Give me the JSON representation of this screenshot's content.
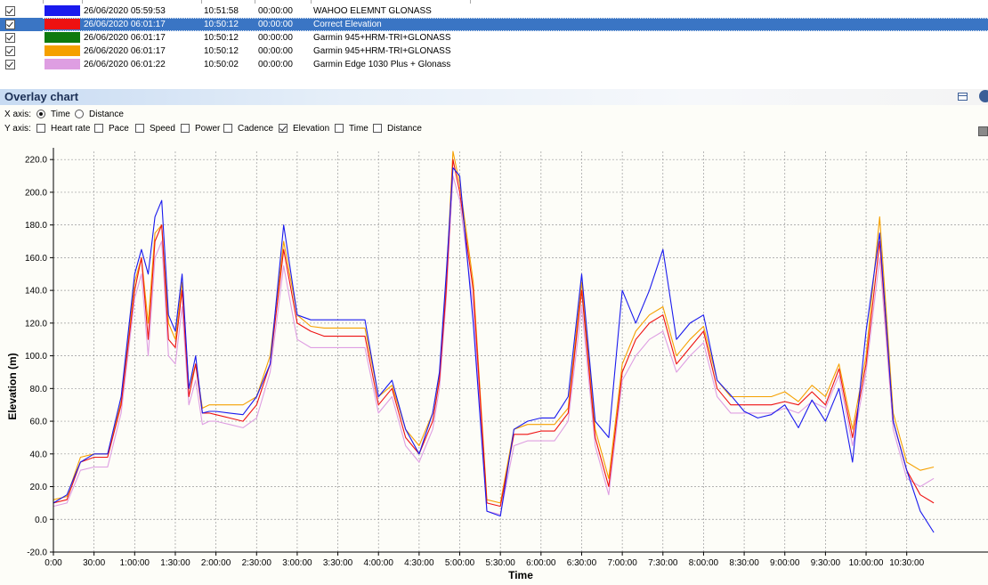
{
  "activities": [
    {
      "checked": true,
      "color": "#1a1aee",
      "date": "26/06/2020 05:59:53",
      "duration": "10:51:58",
      "pause": "00:00:00",
      "name": "WAHOO ELEMNT GLONASS",
      "selected": false
    },
    {
      "checked": true,
      "color": "#ee1111",
      "date": "26/06/2020 06:01:17",
      "duration": "10:50:12",
      "pause": "00:00:00",
      "name": "Correct Elevation",
      "selected": true
    },
    {
      "checked": true,
      "color": "#0e7a0e",
      "date": "26/06/2020 06:01:17",
      "duration": "10:50:12",
      "pause": "00:00:00",
      "name": "Garmin 945+HRM-TRI+GLONASS",
      "selected": false
    },
    {
      "checked": true,
      "color": "#f5a000",
      "date": "26/06/2020 06:01:17",
      "duration": "10:50:12",
      "pause": "00:00:00",
      "name": "Garmin 945+HRM-TRI+GLONASS",
      "selected": false
    },
    {
      "checked": true,
      "color": "#de9ee2",
      "date": "26/06/2020 06:01:22",
      "duration": "10:50:02",
      "pause": "00:00:00",
      "name": "Garmin Edge 1030 Plus + Glonass",
      "selected": false
    }
  ],
  "panel": {
    "title": "Overlay chart"
  },
  "xaxis_options": {
    "label": "X axis:",
    "options": [
      {
        "label": "Time",
        "selected": true
      },
      {
        "label": "Distance",
        "selected": false
      }
    ]
  },
  "yaxis_options": {
    "label": "Y axis:",
    "options": [
      {
        "label": "Heart rate",
        "checked": false
      },
      {
        "label": "Pace",
        "checked": false
      },
      {
        "label": "Speed",
        "checked": false
      },
      {
        "label": "Power",
        "checked": false
      },
      {
        "label": "Cadence",
        "checked": false
      },
      {
        "label": "Elevation",
        "checked": true
      },
      {
        "label": "Time",
        "checked": false
      },
      {
        "label": "Distance",
        "checked": false
      }
    ]
  },
  "chart_data": {
    "type": "line",
    "xlabel": "Time",
    "ylabel": "Elevation (m)",
    "ylim": [
      -20,
      225
    ],
    "yticks": [
      -20,
      0,
      20,
      40,
      60,
      80,
      100,
      120,
      140,
      160,
      180,
      200,
      220
    ],
    "ytick_labels": [
      "-20.0",
      "0.0",
      "20.0",
      "40.0",
      "60.0",
      "80.0",
      "100.0",
      "120.0",
      "140.0",
      "160.0",
      "180.0",
      "200.0",
      "220.0"
    ],
    "xlim": [
      "0:00",
      "11:30"
    ],
    "xtick_labels": [
      "0:00",
      "30:00",
      "1:00:00",
      "1:30:00",
      "2:00:00",
      "2:30:00",
      "3:00:00",
      "3:30:00",
      "4:00:00",
      "4:30:00",
      "5:00:00",
      "5:30:00",
      "6:00:00",
      "6:30:00",
      "7:00:00",
      "7:30:00",
      "8:00:00",
      "8:30:00",
      "9:00:00",
      "9:30:00",
      "10:00:00",
      "10:30:00"
    ],
    "grid": true,
    "x": [
      "0:00",
      "0:10",
      "0:20",
      "0:30",
      "0:40",
      "0:50",
      "1:00",
      "1:05",
      "1:10",
      "1:15",
      "1:20",
      "1:25",
      "1:30",
      "1:35",
      "1:40",
      "1:45",
      "1:50",
      "1:55",
      "2:00",
      "2:10",
      "2:20",
      "2:30",
      "2:40",
      "2:50",
      "3:00",
      "3:10",
      "3:20",
      "3:30",
      "3:40",
      "3:50",
      "4:00",
      "4:10",
      "4:20",
      "4:30",
      "4:40",
      "4:45",
      "4:50",
      "4:55",
      "5:00",
      "5:10",
      "5:20",
      "5:30",
      "5:40",
      "5:50",
      "6:00",
      "6:10",
      "6:20",
      "6:30",
      "6:40",
      "6:50",
      "7:00",
      "7:10",
      "7:20",
      "7:30",
      "7:40",
      "7:50",
      "8:00",
      "8:10",
      "8:20",
      "8:30",
      "8:40",
      "8:50",
      "9:00",
      "9:10",
      "9:20",
      "9:30",
      "9:40",
      "9:50",
      "10:00",
      "10:10",
      "10:20",
      "10:30",
      "10:40",
      "10:50"
    ],
    "series": [
      {
        "name": "WAHOO ELEMNT GLONASS",
        "color": "#1a1aee",
        "values": [
          10,
          15,
          35,
          40,
          40,
          75,
          150,
          165,
          150,
          185,
          195,
          125,
          115,
          150,
          80,
          100,
          65,
          66,
          66,
          65,
          64,
          75,
          95,
          180,
          125,
          122,
          122,
          122,
          122,
          122,
          75,
          85,
          55,
          40,
          65,
          90,
          150,
          215,
          210,
          120,
          5,
          2,
          55,
          60,
          62,
          62,
          75,
          150,
          60,
          50,
          140,
          120,
          140,
          165,
          110,
          120,
          125,
          85,
          76,
          66,
          62,
          64,
          70,
          56,
          73,
          60,
          80,
          35,
          115,
          175,
          60,
          30,
          5,
          -8
        ]
      },
      {
        "name": "Correct Elevation",
        "color": "#ee1111",
        "values": [
          10,
          12,
          35,
          38,
          38,
          70,
          140,
          160,
          110,
          170,
          180,
          110,
          105,
          140,
          75,
          95,
          65,
          65,
          64,
          62,
          60,
          70,
          95,
          165,
          120,
          115,
          112,
          112,
          112,
          112,
          70,
          80,
          50,
          40,
          60,
          85,
          140,
          220,
          200,
          140,
          10,
          8,
          52,
          52,
          54,
          54,
          65,
          140,
          50,
          20,
          90,
          110,
          120,
          125,
          95,
          105,
          115,
          80,
          70,
          70,
          70,
          70,
          72,
          70,
          78,
          70,
          92,
          50,
          95,
          170,
          60,
          30,
          15,
          10
        ]
      },
      {
        "name": "Garmin 945+HRM-TRI+GLONASS",
        "color": "#f5a000",
        "values": [
          12,
          14,
          38,
          40,
          40,
          72,
          145,
          160,
          120,
          175,
          180,
          120,
          110,
          145,
          80,
          95,
          68,
          70,
          70,
          70,
          70,
          75,
          100,
          170,
          125,
          118,
          117,
          117,
          117,
          117,
          75,
          82,
          55,
          45,
          65,
          88,
          145,
          225,
          205,
          145,
          12,
          10,
          55,
          58,
          58,
          58,
          68,
          145,
          55,
          25,
          95,
          115,
          125,
          130,
          100,
          110,
          118,
          85,
          75,
          75,
          75,
          75,
          78,
          72,
          82,
          75,
          95,
          55,
          100,
          185,
          65,
          35,
          30,
          32
        ]
      },
      {
        "name": "Garmin Edge 1030 Plus + Glonass",
        "color": "#de9ee2",
        "values": [
          8,
          10,
          30,
          32,
          32,
          65,
          135,
          150,
          100,
          160,
          170,
          100,
          95,
          130,
          70,
          85,
          58,
          60,
          60,
          58,
          56,
          62,
          90,
          155,
          110,
          105,
          105,
          105,
          105,
          105,
          65,
          75,
          45,
          35,
          55,
          80,
          135,
          210,
          195,
          130,
          5,
          3,
          45,
          48,
          48,
          48,
          60,
          130,
          45,
          15,
          85,
          100,
          110,
          115,
          90,
          100,
          108,
          75,
          65,
          65,
          65,
          65,
          68,
          65,
          72,
          68,
          88,
          45,
          90,
          160,
          55,
          25,
          20,
          25
        ]
      }
    ]
  }
}
